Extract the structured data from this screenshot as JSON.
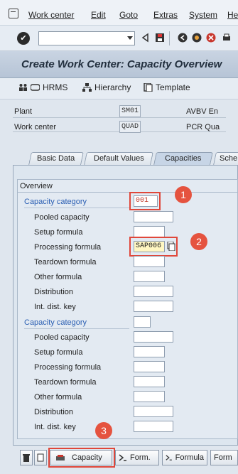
{
  "menubar": {
    "items": [
      "Work center",
      "Edit",
      "Goto",
      "Extras",
      "System",
      "He"
    ]
  },
  "toolbar": {
    "command_value": ""
  },
  "page_title": "Create Work Center: Capacity Overview",
  "app_toolbar": {
    "hrms": "HRMS",
    "hierarchy": "Hierarchy",
    "template": "Template"
  },
  "header": {
    "plant_label": "Plant",
    "plant_value": "SM01",
    "plant_desc": "AVBV En",
    "workcenter_label": "Work center",
    "workcenter_value": "QUAD",
    "workcenter_desc": "PCR Qua"
  },
  "tabs": [
    "Basic Data",
    "Default Values",
    "Capacities",
    "Sche"
  ],
  "overview": {
    "title": "Overview",
    "category_label": "Capacity category",
    "category1_value": "001",
    "rows": [
      "Pooled capacity",
      "Setup formula",
      "Processing formula",
      "Teardown formula",
      "Other formula",
      "Distribution",
      "Int. dist. key"
    ],
    "processing_formula_value": "SAP006"
  },
  "markers": [
    "1",
    "2",
    "3"
  ],
  "bottom_buttons": {
    "capacity": "Capacity",
    "formula1": "Form.",
    "formula2": "Formula",
    "formula3": "Form"
  },
  "colors": {
    "highlight": "#e0473a",
    "marker": "#e5533f",
    "category_label": "#2b5fb3"
  }
}
